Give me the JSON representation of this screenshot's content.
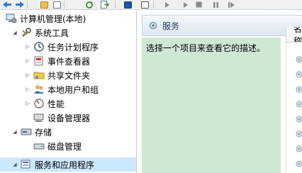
{
  "tree": {
    "items": [
      {
        "label": "计算机管理(本地)",
        "icon": "computer-management-icon",
        "expander": ""
      },
      {
        "label": "系统工具",
        "icon": "tools-icon",
        "expander": "expanded"
      },
      {
        "label": "任务计划程序",
        "icon": "task-scheduler-icon",
        "expander": "collapsed"
      },
      {
        "label": "事件查看器",
        "icon": "event-viewer-icon",
        "expander": "collapsed"
      },
      {
        "label": "共享文件夹",
        "icon": "shared-folder-icon",
        "expander": "collapsed"
      },
      {
        "label": "本地用户和组",
        "icon": "users-icon",
        "expander": "collapsed"
      },
      {
        "label": "性能",
        "icon": "performance-icon",
        "expander": "collapsed"
      },
      {
        "label": "设备管理器",
        "icon": "device-manager-icon",
        "expander": ""
      },
      {
        "label": "存储",
        "icon": "storage-icon",
        "expander": "expanded"
      },
      {
        "label": "磁盘管理",
        "icon": "disk-management-icon",
        "expander": ""
      },
      {
        "label": "服务和应用程序",
        "icon": "services-apps-icon",
        "expander": "expanded"
      }
    ]
  },
  "panel": {
    "title": "服务",
    "description": "选择一个项目来查看它的描述。",
    "column_header": "名称"
  },
  "colors": {
    "selection": "#cce8ff",
    "description_bg": "#cfe8d4",
    "header_text": "#1e395b"
  }
}
